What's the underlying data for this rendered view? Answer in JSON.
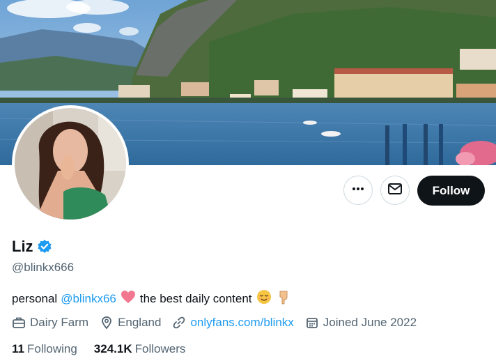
{
  "profile": {
    "display_name": "Liz",
    "handle": "@blinkx666",
    "verified": true
  },
  "bio": {
    "text_before": "personal",
    "mention": "@blinkx66",
    "text_after": "the best daily content"
  },
  "meta": {
    "work": "Dairy Farm",
    "location": "England",
    "website": "onlyfans.com/blinkx",
    "joined": "Joined June 2022"
  },
  "counts": {
    "following_value": "11",
    "following_label": "Following",
    "followers_value": "324.1K",
    "followers_label": "Followers"
  },
  "actions": {
    "follow_label": "Follow",
    "more_icon": "more-horizontal-icon",
    "message_icon": "envelope-icon"
  },
  "colors": {
    "accent": "#1d9bf0",
    "primary_text": "#0f1419",
    "secondary_text": "#536471",
    "follow_button": "#0f1419",
    "border": "#cfd9de"
  }
}
